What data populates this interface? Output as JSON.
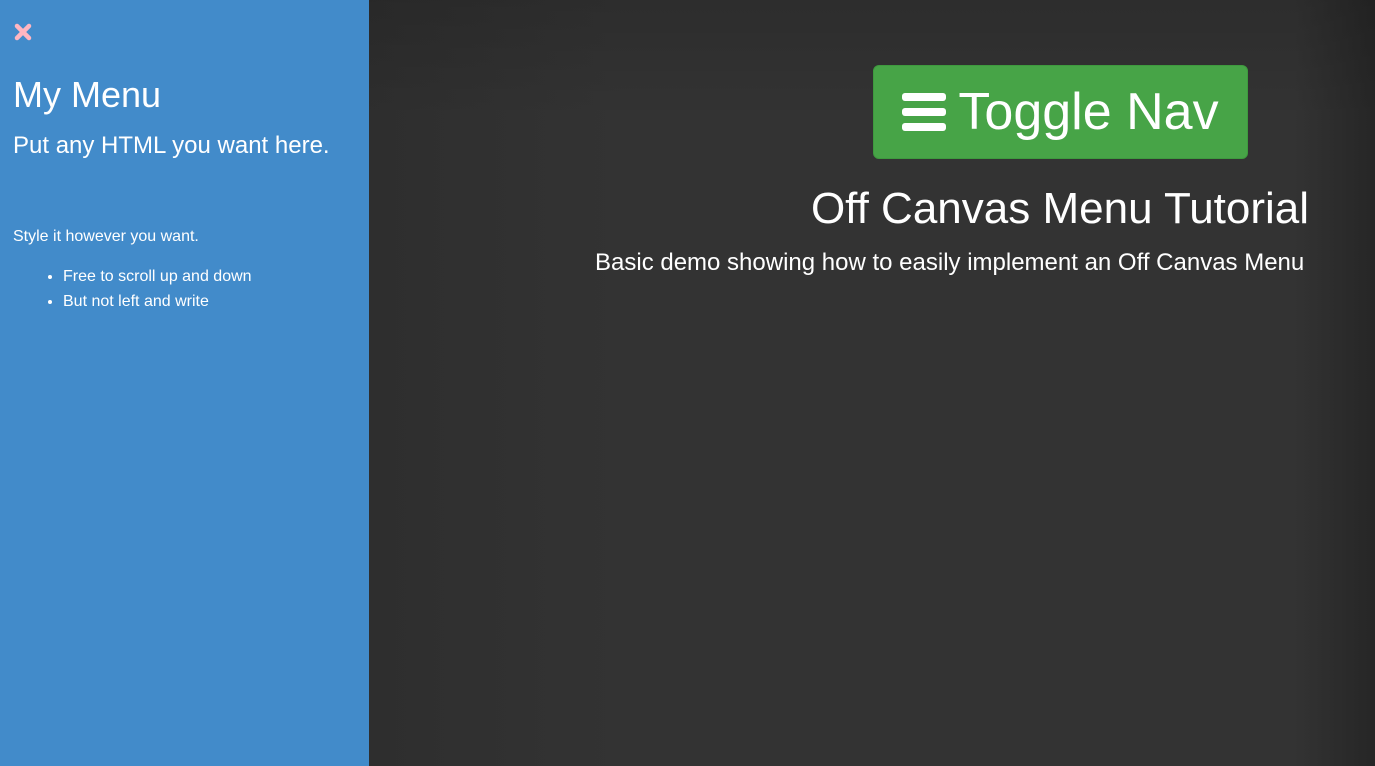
{
  "sidebar": {
    "close_icon": "close-icon",
    "close_color": "#ffb6c1",
    "title": "My Menu",
    "subtitle": "Put any HTML you want here.",
    "text": "Style it however you want.",
    "items": [
      {
        "label": "Free to scroll up and down"
      },
      {
        "label": "But not left and write"
      }
    ],
    "background": "#428bca"
  },
  "main": {
    "toggle_button": {
      "icon": "hamburger-icon",
      "label": "Toggle Nav",
      "color": "#47a447"
    },
    "title": "Off Canvas Menu Tutorial",
    "subtitle": "Basic demo showing how to easily implement an Off Canvas Menu",
    "background": "#333333"
  }
}
